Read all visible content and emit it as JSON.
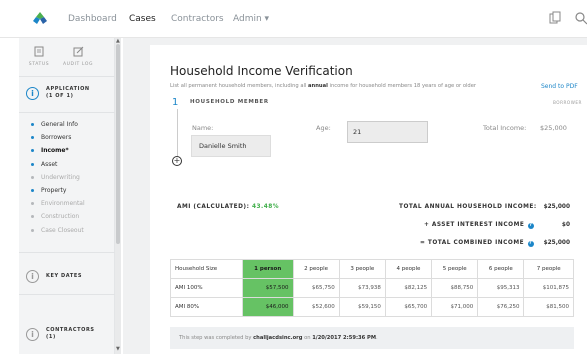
{
  "nav": {
    "items": [
      "Dashboard",
      "Cases",
      "Contractors",
      "Admin ▾"
    ],
    "active": "Cases"
  },
  "sidebar": {
    "tools": [
      {
        "label": "STATUS",
        "icon": "document-icon"
      },
      {
        "label": "AUDIT LOG",
        "icon": "edit-icon"
      }
    ],
    "application": {
      "title": "APPLICATION",
      "sub": "(1 OF 1)"
    },
    "items": [
      {
        "label": "General Info",
        "state": "done"
      },
      {
        "label": "Borrowers",
        "state": "done"
      },
      {
        "label": "Income*",
        "state": "current"
      },
      {
        "label": "Asset",
        "state": "done"
      },
      {
        "label": "Underwriting",
        "state": "disabled"
      },
      {
        "label": "Property",
        "state": "done"
      },
      {
        "label": "Environmental",
        "state": "disabled"
      },
      {
        "label": "Construction",
        "state": "disabled"
      },
      {
        "label": "Case Closeout",
        "state": "disabled"
      }
    ],
    "key_dates": {
      "title": "KEY DATES"
    },
    "contractors": {
      "title": "CONTRACTORS",
      "sub": "(1)"
    }
  },
  "main": {
    "title": "Household Income Verification",
    "subtitle_pre": "List all permanent household members, including all ",
    "subtitle_bold": "annual",
    "subtitle_post": " income for household members 18 years of age or older",
    "send_pdf": "Send to PDF",
    "step": {
      "number": "1",
      "title": "HOUSEHOLD MEMBER",
      "tag": "BORROWER"
    },
    "member": {
      "name_label": "Name:",
      "name_value": "Danielle Smith",
      "age_label": "Age:",
      "age_value": "21",
      "total_label": "Total Income:",
      "total_value": "$25,000"
    },
    "add_button": "+",
    "ami": {
      "label": "AMI (CALCULATED):",
      "value": "43.48%"
    },
    "summary": [
      {
        "label": "TOTAL ANNUAL HOUSEHOLD INCOME:",
        "value": "$25,000"
      },
      {
        "label": "+ ASSET INTEREST INCOME",
        "value": "$0"
      },
      {
        "label": "= TOTAL COMBINED INCOME",
        "value": "$25,000"
      }
    ],
    "table": {
      "headers": [
        "Household Size",
        "1 person",
        "2 people",
        "3 people",
        "4 people",
        "5 people",
        "6 people",
        "7 people"
      ],
      "rows": [
        [
          "AMI 100%",
          "$57,500",
          "$65,750",
          "$73,938",
          "$82,125",
          "$88,750",
          "$95,313",
          "$101,875"
        ],
        [
          "AMI 80%",
          "$46,000",
          "$52,600",
          "$59,150",
          "$65,700",
          "$71,000",
          "$76,250",
          "$81,500"
        ]
      ],
      "highlight_column": 1,
      "highlight_color": "#66c264"
    },
    "completion": {
      "pre": "This step was completed by ",
      "user": "challjacdsinc.org",
      "mid": " on ",
      "date": "1/20/2017 2:59:36 PM",
      "post": "."
    }
  },
  "colors": {
    "accent": "#1c86c8",
    "success": "#3fae49"
  }
}
